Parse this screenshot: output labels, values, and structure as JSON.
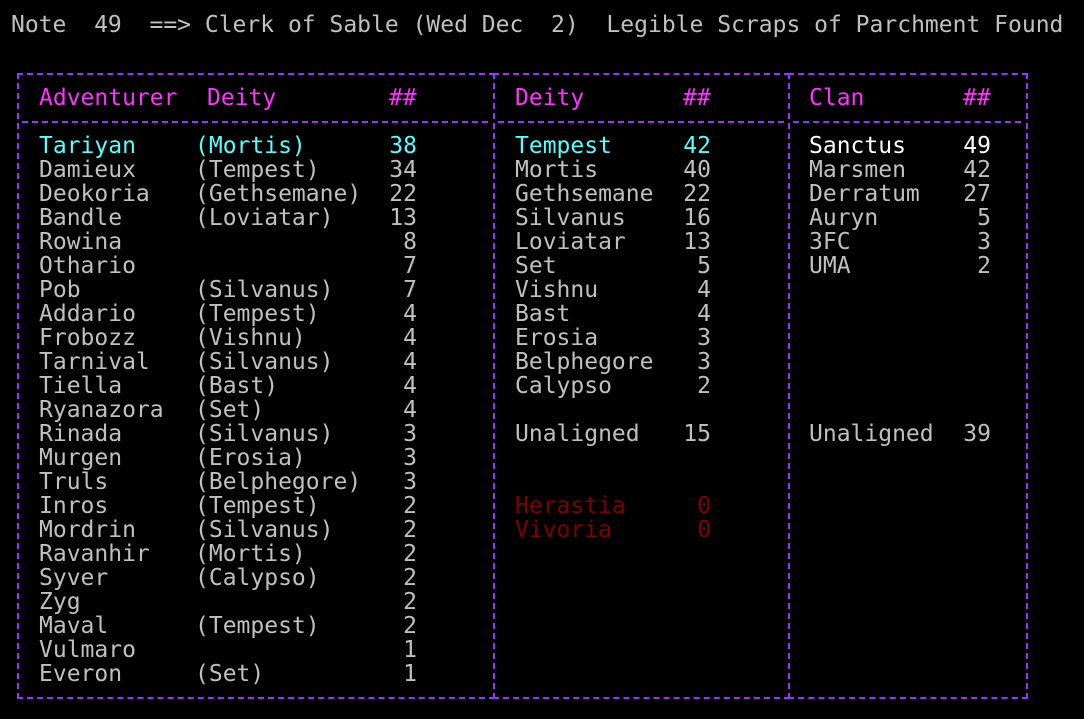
{
  "title": "Note  49  ==> Clerk of Sable (Wed Dec  2)  Legible Scraps of Parchment Found",
  "colors": {
    "background": "#000000",
    "text": "#c0c0c0",
    "border": "#9933ff",
    "header": "#ff33ff",
    "highlight": "#55ffff",
    "bright": "#ffffff",
    "dim": "#800000"
  },
  "adventurers": {
    "headers": {
      "name": "Adventurer",
      "deity": "Deity",
      "count": "##"
    },
    "rows": [
      {
        "name": "Tariyan",
        "deity": "(Mortis)",
        "count": "38"
      },
      {
        "name": "Damieux",
        "deity": "(Tempest)",
        "count": "34"
      },
      {
        "name": "Deokoria",
        "deity": "(Gethsemane)",
        "count": "22"
      },
      {
        "name": "Bandle",
        "deity": "(Loviatar)",
        "count": "13"
      },
      {
        "name": "Rowina",
        "deity": "",
        "count": "8"
      },
      {
        "name": "Othario",
        "deity": "",
        "count": "7"
      },
      {
        "name": "Pob",
        "deity": "(Silvanus)",
        "count": "7"
      },
      {
        "name": "Addario",
        "deity": "(Tempest)",
        "count": "4"
      },
      {
        "name": "Frobozz",
        "deity": "(Vishnu)",
        "count": "4"
      },
      {
        "name": "Tarnival",
        "deity": "(Silvanus)",
        "count": "4"
      },
      {
        "name": "Tiella",
        "deity": "(Bast)",
        "count": "4"
      },
      {
        "name": "Ryanazora",
        "deity": "(Set)",
        "count": "4"
      },
      {
        "name": "Rinada",
        "deity": "(Silvanus)",
        "count": "3"
      },
      {
        "name": "Murgen",
        "deity": "(Erosia)",
        "count": "3"
      },
      {
        "name": "Truls",
        "deity": "(Belphegore)",
        "count": "3"
      },
      {
        "name": "Inros",
        "deity": "(Tempest)",
        "count": "2"
      },
      {
        "name": "Mordrin",
        "deity": "(Silvanus)",
        "count": "2"
      },
      {
        "name": "Ravanhir",
        "deity": "(Mortis)",
        "count": "2"
      },
      {
        "name": "Syver",
        "deity": "(Calypso)",
        "count": "2"
      },
      {
        "name": "Zyg",
        "deity": "",
        "count": "2"
      },
      {
        "name": "Maval",
        "deity": "(Tempest)",
        "count": "2"
      },
      {
        "name": "Vulmaro",
        "deity": "",
        "count": "1"
      },
      {
        "name": "Everon",
        "deity": "(Set)",
        "count": "1"
      }
    ]
  },
  "deities": {
    "headers": {
      "name": "Deity",
      "count": "##"
    },
    "rows": [
      {
        "name": "Tempest",
        "count": "42"
      },
      {
        "name": "Mortis",
        "count": "40"
      },
      {
        "name": "Gethsemane",
        "count": "22"
      },
      {
        "name": "Silvanus",
        "count": "16"
      },
      {
        "name": "Loviatar",
        "count": "13"
      },
      {
        "name": "Set",
        "count": "5"
      },
      {
        "name": "Vishnu",
        "count": "4"
      },
      {
        "name": "Bast",
        "count": "4"
      },
      {
        "name": "Erosia",
        "count": "3"
      },
      {
        "name": "Belphegore",
        "count": "3"
      },
      {
        "name": "Calypso",
        "count": "2"
      }
    ],
    "unaligned": {
      "name": "Unaligned",
      "count": "15"
    },
    "inactive": [
      {
        "name": "Herastia",
        "count": "0"
      },
      {
        "name": "Vivoria",
        "count": "0"
      }
    ]
  },
  "clans": {
    "headers": {
      "name": "Clan",
      "count": "##"
    },
    "rows": [
      {
        "name": "Sanctus",
        "count": "49"
      },
      {
        "name": "Marsmen",
        "count": "42"
      },
      {
        "name": "Derratum",
        "count": "27"
      },
      {
        "name": "Auryn",
        "count": "5"
      },
      {
        "name": "3FC",
        "count": "3"
      },
      {
        "name": "UMA",
        "count": "2"
      }
    ],
    "unaligned": {
      "name": "Unaligned",
      "count": "39"
    }
  }
}
